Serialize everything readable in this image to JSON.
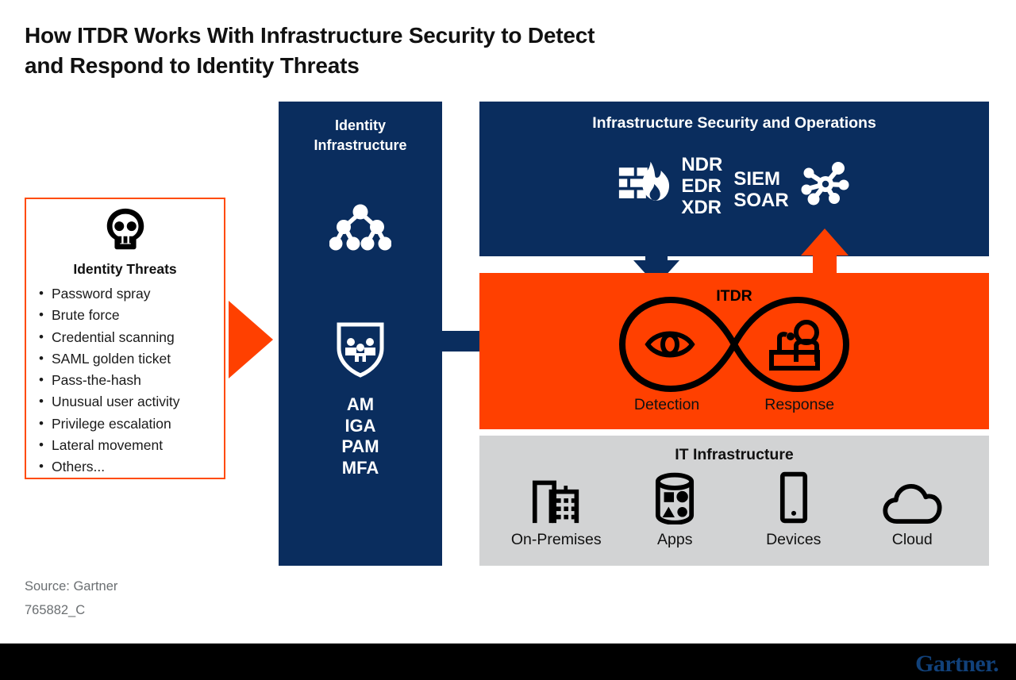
{
  "title": {
    "line1": "How ITDR Works With Infrastructure Security to Detect",
    "line2": "and Respond to Identity Threats"
  },
  "threats": {
    "heading": "Identity Threats",
    "icon": "skull-icon",
    "items": [
      "Password spray",
      "Brute force",
      "Credential scanning",
      "SAML golden ticket",
      "Pass-the-hash",
      "Unusual user activity",
      "Privilege escalation",
      "Lateral movement",
      "Others..."
    ]
  },
  "identity_infrastructure": {
    "title_line1": "Identity",
    "title_line2": "Infrastructure",
    "icons": [
      "tree-network-icon",
      "shield-people-icon"
    ],
    "acronyms": [
      "AM",
      "IGA",
      "PAM",
      "MFA"
    ]
  },
  "infrastructure_security": {
    "title": "Infrastructure Security and Operations",
    "firewall_icon": "firewall-flame-icon",
    "acronyms_group_1": [
      "NDR",
      "EDR",
      "XDR"
    ],
    "acronyms_group_2": [
      "SIEM",
      "SOAR"
    ],
    "hub_icon": "network-hub-icon"
  },
  "itdr": {
    "label": "ITDR",
    "detection_caption": "Detection",
    "response_caption": "Response",
    "detection_icon": "eye-icon",
    "response_icon": "person-at-desk-icon"
  },
  "it_infrastructure": {
    "title": "IT Infrastructure",
    "items": [
      {
        "label": "On-Premises",
        "icon": "buildings-icon"
      },
      {
        "label": "Apps",
        "icon": "database-shapes-icon"
      },
      {
        "label": "Devices",
        "icon": "mobile-phone-icon"
      },
      {
        "label": "Cloud",
        "icon": "cloud-icon"
      }
    ]
  },
  "arrows": {
    "threat_to_identity": "orange-triangle-arrow",
    "identity_to_itdr": "navy-right-arrow",
    "security_to_itdr": "navy-down-arrow",
    "itdr_to_security": "orange-up-arrow"
  },
  "footer": {
    "source": "Source: Gartner",
    "doc_id": "765882_C",
    "logo": "Gartner."
  },
  "colors": {
    "navy": "#0A2D5E",
    "orange": "#FF4000",
    "gray": "#D2D3D4",
    "logo_navy": "#11417A"
  }
}
